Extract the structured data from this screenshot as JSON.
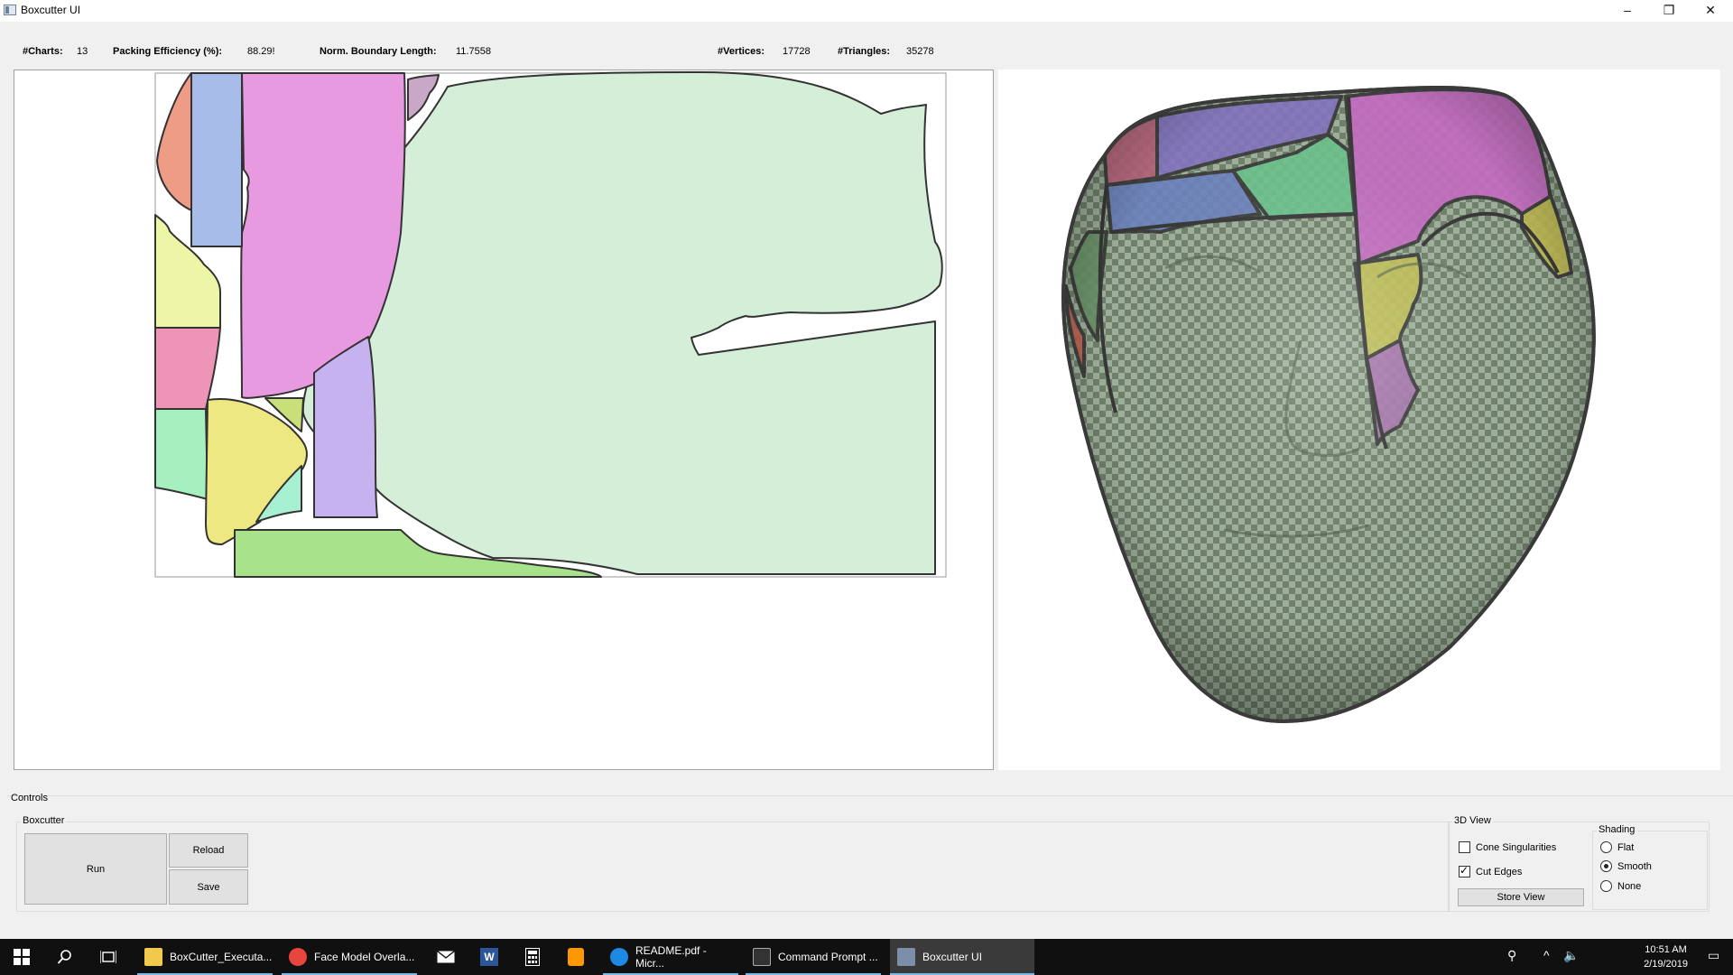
{
  "window": {
    "title": "Boxcutter UI",
    "minimize": "–",
    "restore": "❐",
    "close": "✕"
  },
  "stats": {
    "charts_label": "#Charts:",
    "charts_value": "13",
    "packing_label": "Packing Efficiency (%):",
    "packing_value": "88.29!",
    "boundary_label": "Norm. Boundary Length:",
    "boundary_value": "11.7558",
    "vertices_label": "#Vertices:",
    "vertices_value": "17728",
    "triangles_label": "#Triangles:",
    "triangles_value": "35278"
  },
  "uv_chart_colors": {
    "big_green": "#d5eed8",
    "pink": "#e89ae0",
    "blue": "#a7bce9",
    "salmon": "#ef9c86",
    "lime_pale": "#ecf6a6",
    "rose": "#ee94b6",
    "mint": "#a6f0c0",
    "yellow": "#ede882",
    "lavender": "#c6b2ef",
    "green_bottom": "#a8e28a",
    "mauve": "#c9a7c6",
    "olive": "#c9e07a",
    "aqua": "#a8f0d2"
  },
  "model": {
    "base_color": "#8fa28d",
    "checker_dark": "#6e7f6c",
    "cut_edge_color": "#3a3a3a",
    "patch_colors": [
      "#c45a7a",
      "#7a6ec8",
      "#d46fcf",
      "#6ec79a",
      "#6d87c9",
      "#c9c451",
      "#b07ab8",
      "#cc6b5a"
    ]
  },
  "controls": {
    "title": "Controls",
    "boxcutter_group": "Boxcutter",
    "run": "Run",
    "reload": "Reload",
    "save": "Save",
    "view3d_group": "3D View",
    "cone_singularities": "Cone Singularities",
    "cone_singularities_checked": false,
    "cut_edges": "Cut Edges",
    "cut_edges_checked": true,
    "store_view": "Store View",
    "shading_group": "Shading",
    "shading_flat": "Flat",
    "shading_smooth": "Smooth",
    "shading_none": "None",
    "shading_selected": "Smooth"
  },
  "taskbar": {
    "apps": [
      {
        "label": "BoxCutter_Executa...",
        "color": "#f2c94c"
      },
      {
        "label": "Face Model Overla...",
        "color": "#e8453c"
      },
      {
        "label": "README.pdf - Micr...",
        "color": "#1e88e5"
      },
      {
        "label": "Command Prompt ...",
        "color": "#444444"
      },
      {
        "label": "Boxcutter UI",
        "color": "#7d8fa8"
      }
    ],
    "time": "10:51 AM",
    "date": "2/19/2019"
  }
}
